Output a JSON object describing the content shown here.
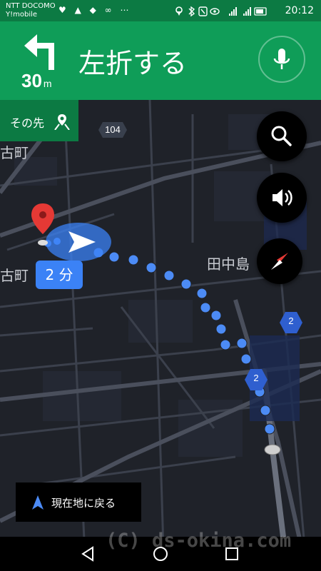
{
  "status_bar": {
    "carrier_line1": "NTT DOCOMO",
    "carrier_line2": "Y!mobile",
    "left_icons": "♥ ▲ ◆ ∞ ⋯",
    "right_icons": "◎ ✱ Ⓝ ◉ ▂▄▆ ▂▄▆",
    "time": "20:12"
  },
  "navigation": {
    "turn_icon": "turn-left-arrow-icon",
    "distance_value": "30",
    "distance_unit": "m",
    "instruction": "左折する",
    "then_label": "その先"
  },
  "map": {
    "place_labels": [
      "古町",
      "田中島"
    ],
    "road_badge_104": "104",
    "route_badge_1": "2",
    "route_badge_2": "2",
    "eta_label": "2 分"
  },
  "controls": {
    "search_icon": "search-icon",
    "sound_icon": "volume-icon",
    "compass_icon": "compass-icon",
    "mic_icon": "mic-icon"
  },
  "return_button": {
    "label": "現在地に戻る"
  },
  "watermark": "(C) ds-okina.com",
  "system_nav": [
    "back",
    "home",
    "recents"
  ],
  "colors": {
    "nav_green": "#0f9d58",
    "dark_green": "#0c7a43",
    "route_blue": "#3b82f6",
    "map_bg": "#1f2229"
  }
}
